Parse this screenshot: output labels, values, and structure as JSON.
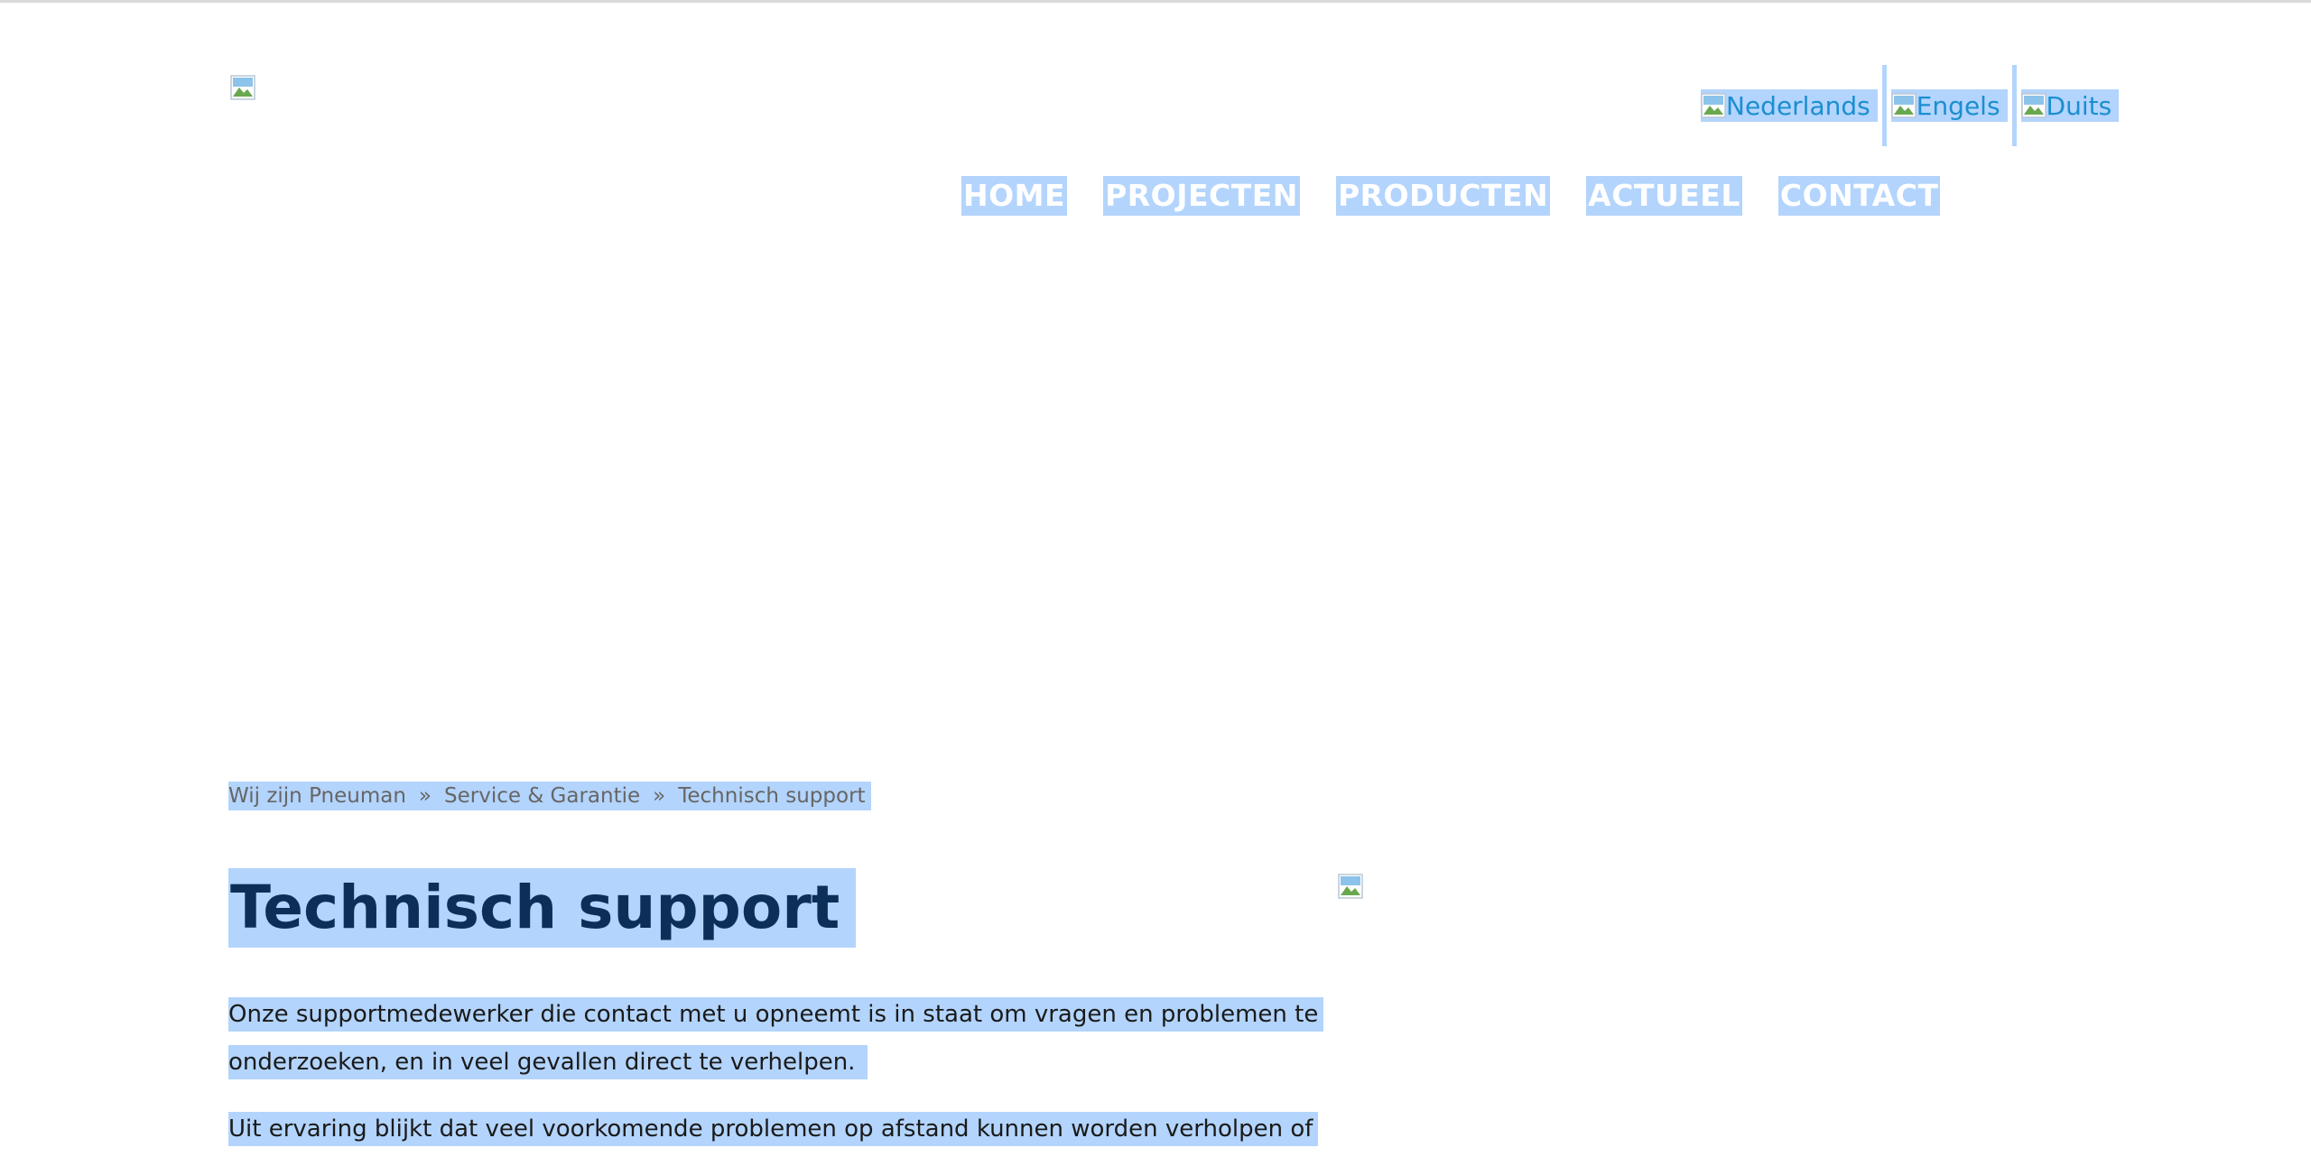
{
  "header": {
    "logo_icon": "broken-image-icon",
    "languages": [
      {
        "label": "Nederlands",
        "icon": "broken-image-icon"
      },
      {
        "label": "Engels",
        "icon": "broken-image-icon"
      },
      {
        "label": "Duits",
        "icon": "broken-image-icon"
      }
    ],
    "nav": [
      "HOME",
      "PROJECTEN",
      "PRODUCTEN",
      "ACTUEEL",
      "CONTACT"
    ]
  },
  "breadcrumb": {
    "items": [
      "Wij zijn Pneuman",
      "Service & Garantie",
      "Technisch support"
    ],
    "separator": "»"
  },
  "content": {
    "title": "Technisch support",
    "paragraph_lines": [
      "Onze supportmedewerker die contact met u opneemt is in staat om vragen en problemen te",
      "onderzoeken, en in veel gevallen direct te verhelpen.",
      "Uit ervaring blijkt dat veel voorkomende problemen op afstand kunnen worden verholpen of"
    ],
    "side_image_icon": "broken-image-icon"
  },
  "colors": {
    "selection": "#b3d4fc",
    "link": "#1a8fd1",
    "title": "#0c2f5a",
    "breadcrumb_text": "#666666"
  }
}
